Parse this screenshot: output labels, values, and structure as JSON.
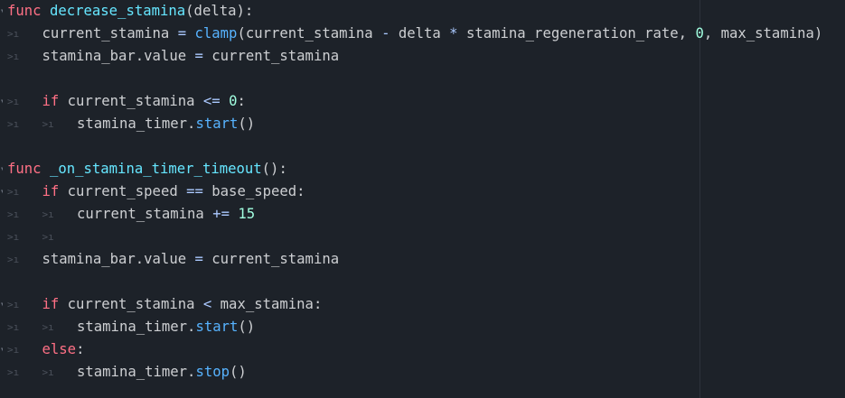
{
  "editor": {
    "tab_glyph": ">ı",
    "fold_glyph": "▾",
    "lines": [
      {
        "tokens": [
          {
            "t": "kw",
            "v": "func"
          },
          {
            "t": "txt",
            "v": " "
          },
          {
            "t": "fn",
            "v": "decrease_stamina"
          },
          {
            "t": "txt",
            "v": "(delta):"
          }
        ]
      },
      {
        "tokens": [
          {
            "t": "txt",
            "v": "current_stamina "
          },
          {
            "t": "op",
            "v": "="
          },
          {
            "t": "txt",
            "v": " "
          },
          {
            "t": "call",
            "v": "clamp"
          },
          {
            "t": "txt",
            "v": "(current_stamina "
          },
          {
            "t": "op",
            "v": "-"
          },
          {
            "t": "txt",
            "v": " delta "
          },
          {
            "t": "op",
            "v": "*"
          },
          {
            "t": "txt",
            "v": " stamina_regeneration_rate, "
          },
          {
            "t": "num",
            "v": "0"
          },
          {
            "t": "txt",
            "v": ", max_stamina)"
          }
        ]
      },
      {
        "tokens": [
          {
            "t": "txt",
            "v": "stamina_bar.value "
          },
          {
            "t": "op",
            "v": "="
          },
          {
            "t": "txt",
            "v": " current_stamina"
          }
        ]
      },
      {
        "tokens": []
      },
      {
        "tokens": [
          {
            "t": "kw",
            "v": "if"
          },
          {
            "t": "txt",
            "v": " current_stamina "
          },
          {
            "t": "op",
            "v": "<="
          },
          {
            "t": "txt",
            "v": " "
          },
          {
            "t": "num",
            "v": "0"
          },
          {
            "t": "txt",
            "v": ":"
          }
        ]
      },
      {
        "tokens": [
          {
            "t": "txt",
            "v": "stamina_timer."
          },
          {
            "t": "call",
            "v": "start"
          },
          {
            "t": "txt",
            "v": "()"
          }
        ]
      },
      {
        "tokens": []
      },
      {
        "tokens": [
          {
            "t": "kw",
            "v": "func"
          },
          {
            "t": "txt",
            "v": " "
          },
          {
            "t": "fn",
            "v": "_on_stamina_timer_timeout"
          },
          {
            "t": "txt",
            "v": "():"
          }
        ]
      },
      {
        "tokens": [
          {
            "t": "kw",
            "v": "if"
          },
          {
            "t": "txt",
            "v": " current_speed "
          },
          {
            "t": "op",
            "v": "=="
          },
          {
            "t": "txt",
            "v": " base_speed:"
          }
        ]
      },
      {
        "tokens": [
          {
            "t": "txt",
            "v": "current_stamina "
          },
          {
            "t": "op",
            "v": "+="
          },
          {
            "t": "txt",
            "v": " "
          },
          {
            "t": "num",
            "v": "15"
          }
        ]
      },
      {
        "tokens": []
      },
      {
        "tokens": [
          {
            "t": "txt",
            "v": "stamina_bar.value "
          },
          {
            "t": "op",
            "v": "="
          },
          {
            "t": "txt",
            "v": " current_stamina"
          }
        ]
      },
      {
        "tokens": []
      },
      {
        "tokens": [
          {
            "t": "kw",
            "v": "if"
          },
          {
            "t": "txt",
            "v": " current_stamina "
          },
          {
            "t": "op",
            "v": "<"
          },
          {
            "t": "txt",
            "v": " max_stamina:"
          }
        ]
      },
      {
        "tokens": [
          {
            "t": "txt",
            "v": "stamina_timer."
          },
          {
            "t": "call",
            "v": "start"
          },
          {
            "t": "txt",
            "v": "()"
          }
        ]
      },
      {
        "tokens": [
          {
            "t": "kw",
            "v": "else"
          },
          {
            "t": "txt",
            "v": ":"
          }
        ]
      },
      {
        "tokens": [
          {
            "t": "txt",
            "v": "stamina_timer."
          },
          {
            "t": "call",
            "v": "stop"
          },
          {
            "t": "txt",
            "v": "()"
          }
        ]
      }
    ]
  },
  "colors": {
    "background": "#1d2229",
    "keyword": "#ff7085",
    "function_name": "#66e6ff",
    "method_call": "#57b3ff",
    "number": "#a1ffe0",
    "operator": "#abc9ff",
    "text": "#cdcfd2"
  }
}
